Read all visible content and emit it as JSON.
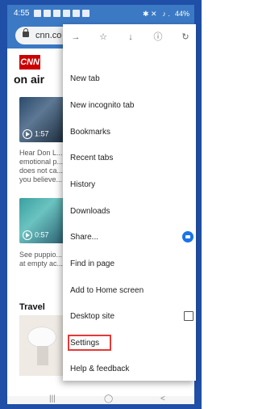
{
  "status_bar": {
    "time": "4:55",
    "right": "✱ ✕   ♪ .   44%"
  },
  "url_bar": {
    "url": "cnn.co"
  },
  "page": {
    "logo": "CNN",
    "section_title": "on air",
    "video1_duration": "1:57",
    "snippet1": "Hear Don L... emotional p... does not ca... you believe...",
    "video2_duration": "0:57",
    "snippet2": "See puppio... at empty ac...",
    "travel_label": "Travel"
  },
  "menu": {
    "items": [
      {
        "label": "New tab"
      },
      {
        "label": "New incognito tab"
      },
      {
        "label": "Bookmarks"
      },
      {
        "label": "Recent tabs"
      },
      {
        "label": "History"
      },
      {
        "label": "Downloads"
      },
      {
        "label": "Share..."
      },
      {
        "label": "Find in page"
      },
      {
        "label": "Add to Home screen"
      },
      {
        "label": "Desktop site"
      },
      {
        "label": "Settings"
      },
      {
        "label": "Help & feedback"
      }
    ]
  },
  "nav_bar": {
    "recents": "|||",
    "home": "◯",
    "back": "<"
  },
  "colors": {
    "frame": "#1f4fa6",
    "toolbar": "#3b79c5",
    "highlight": "#e53935",
    "share_badge": "#1a73e8",
    "cnn_red": "#cc0000"
  }
}
